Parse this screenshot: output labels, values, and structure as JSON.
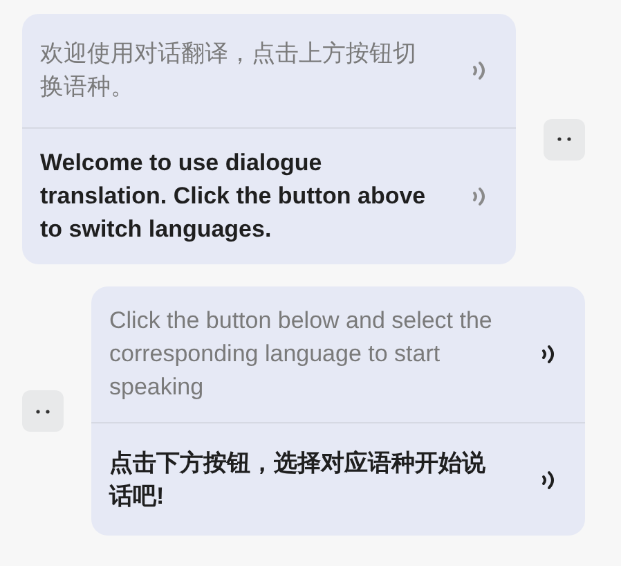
{
  "messages": [
    {
      "kind": "received",
      "speaker_active": false,
      "lines": [
        {
          "kind": "source",
          "text": "欢迎使用对话翻译，点击上方按钮切换语种。"
        },
        {
          "kind": "translation",
          "text": "Welcome to use dialogue translation. Click the button above to switch languages."
        }
      ]
    },
    {
      "kind": "sent",
      "speaker_active": true,
      "lines": [
        {
          "kind": "source",
          "text": "Click the button below and select the corresponding language to start speaking"
        },
        {
          "kind": "translation",
          "text": "点击下方按钮，选择对应语种开始说话吧!"
        }
      ]
    }
  ]
}
